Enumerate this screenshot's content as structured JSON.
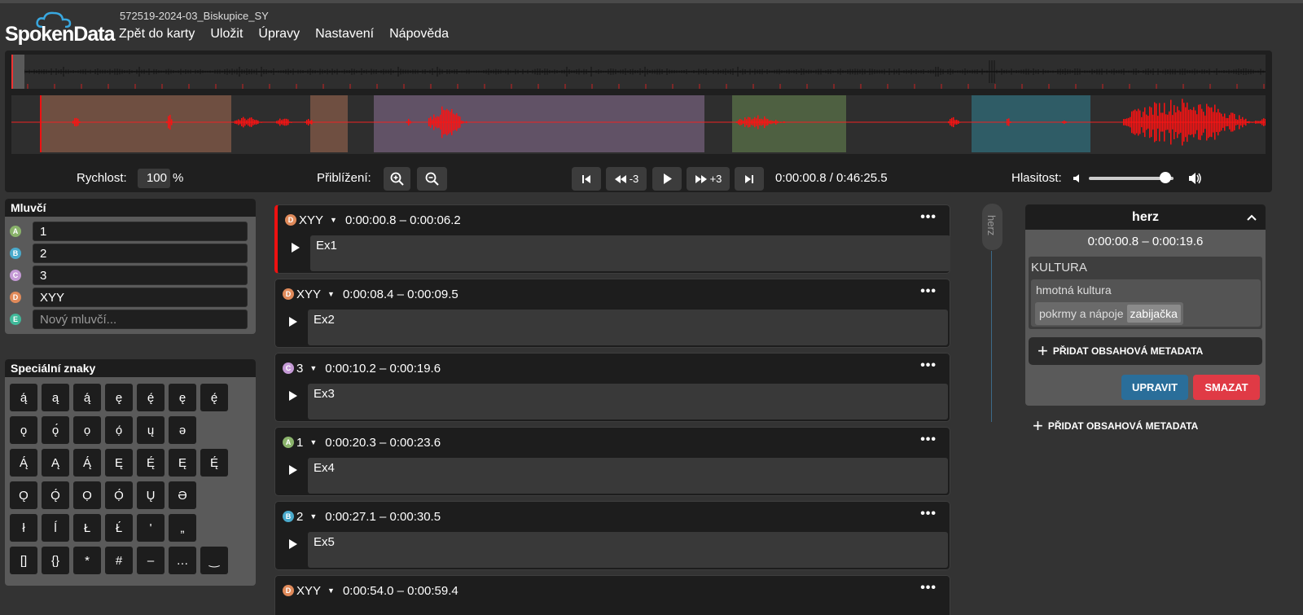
{
  "app": {
    "logo_text": "SpokenData",
    "filename": "572519-2024-03_Biskupice_SY",
    "menu": [
      "Zpět do karty",
      "Uložit",
      "Úpravy",
      "Nastavení",
      "Nápověda"
    ]
  },
  "player": {
    "speed_label": "Rychlost:",
    "speed_value": "100",
    "speed_unit": "%",
    "zoom_label": "Přiblížení:",
    "back_label": "-3",
    "forward_label": "+3",
    "time": "0:00:00.8 / 0:46:25.5",
    "volume_label": "Hlasitost:",
    "volume_level": 0.9
  },
  "speakers": {
    "title": "Mluvčí",
    "items": [
      {
        "badge": "A",
        "name": "1",
        "color": "#8ab36b"
      },
      {
        "badge": "B",
        "name": "2",
        "color": "#4aaacc"
      },
      {
        "badge": "C",
        "name": "3",
        "color": "#c59ad6"
      },
      {
        "badge": "D",
        "name": "XYY",
        "color": "#e08a5a"
      },
      {
        "badge": "E",
        "name": "",
        "placeholder": "Nový mluvčí...",
        "color": "#40b99a"
      }
    ]
  },
  "special_chars": {
    "title": "Speciální znaky",
    "rows": [
      [
        "ą́",
        "ą",
        "ą́",
        "ę",
        "ę́",
        "ę",
        "ę́"
      ],
      [
        "ǫ",
        "ǫ́",
        "ọ",
        "ọ́",
        "ų",
        "ə",
        ""
      ],
      [
        "Ą́",
        "Ą",
        "Ą́",
        "Ę",
        "Ę́",
        "Ę",
        "Ę́"
      ],
      [
        "Ǫ",
        "Ǫ́",
        "Ọ",
        "Ọ́",
        "Ų",
        "Ə",
        ""
      ],
      [
        "ł",
        "ĺ",
        "Ł",
        "Ł́",
        "'",
        "„",
        ""
      ],
      [
        "[]",
        "{}",
        "*",
        "#",
        "–",
        "…",
        "‿"
      ]
    ]
  },
  "segments": [
    {
      "badge": "D",
      "speaker": "XYY",
      "time": "0:00:00.8 – 0:00:06.2",
      "text": "Ex1",
      "color": "#e08a5a",
      "active": true
    },
    {
      "badge": "D",
      "speaker": "XYY",
      "time": "0:00:08.4 – 0:00:09.5",
      "text": "Ex2",
      "color": "#e08a5a"
    },
    {
      "badge": "C",
      "speaker": "3",
      "time": "0:00:10.2 – 0:00:19.6",
      "text": "Ex3",
      "color": "#c59ad6"
    },
    {
      "badge": "A",
      "speaker": "1",
      "time": "0:00:20.3 – 0:00:23.6",
      "text": "Ex4",
      "color": "#8ab36b"
    },
    {
      "badge": "B",
      "speaker": "2",
      "time": "0:00:27.1 – 0:00:30.5",
      "text": "Ex5",
      "color": "#4aaacc"
    },
    {
      "badge": "D",
      "speaker": "XYY",
      "time": "0:00:54.0 – 0:00:59.4",
      "text": "",
      "color": "#e08a5a"
    }
  ],
  "rail": {
    "label": "herz"
  },
  "metadata": {
    "title": "herz",
    "time": "0:00:00.8 – 0:00:19.6",
    "category": "KULTURA",
    "subcategory": "hmotná kultura",
    "leaf": "pokrmy a nápoje",
    "tag": "zabijačka",
    "add_label": "PŘIDAT OBSAHOVÁ METADATA",
    "edit_label": "UPRAVIT",
    "delete_label": "SMAZAT",
    "outer_add_label": "PŘIDAT OBSAHOVÁ METADATA"
  },
  "colors": {
    "accent_red": "#e11111",
    "edit_blue": "#2a6e9a",
    "delete_red": "#e03a45"
  }
}
